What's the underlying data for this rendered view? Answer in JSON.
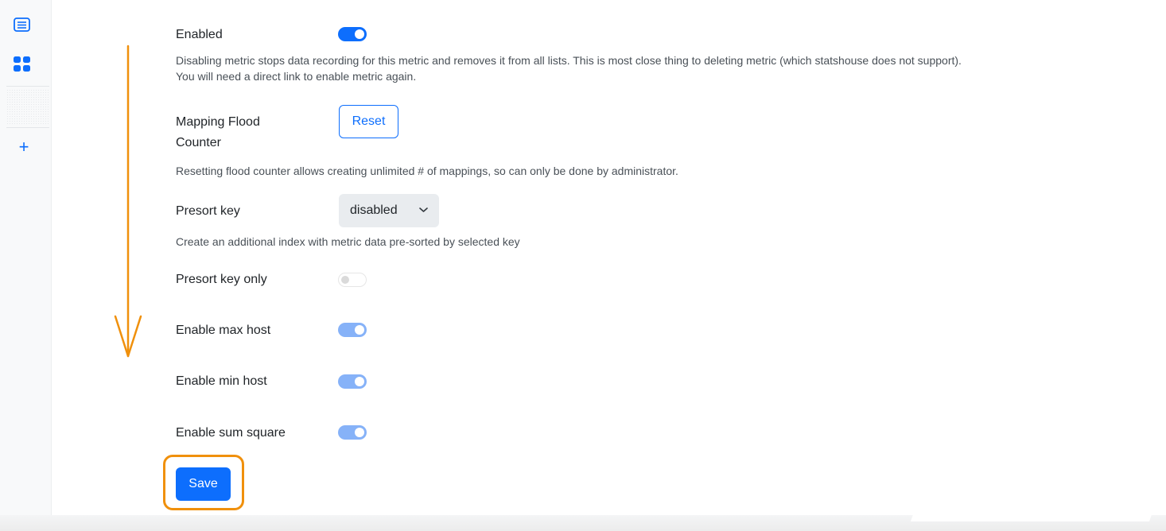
{
  "sidebar": {
    "icons": [
      "list-icon",
      "dashboard-grid-icon",
      "plus-icon"
    ],
    "add_label": "+"
  },
  "form": {
    "enabled": {
      "label": "Enabled",
      "state": "on",
      "description_line1": "Disabling metric stops data recording for this metric and removes it from all lists. This is most close thing to deleting metric (which statshouse does not support).",
      "description_line2": "You will need a direct link to enable metric again."
    },
    "mapping_flood_counter": {
      "label_line1": "Mapping Flood",
      "label_line2": "Counter",
      "button_label": "Reset",
      "description": "Resetting flood counter allows creating unlimited # of mappings, so can only be done by administrator."
    },
    "presort_key": {
      "label": "Presort key",
      "selected_value": "disabled",
      "description": "Create an additional index with metric data pre-sorted by selected key"
    },
    "presort_key_only": {
      "label": "Presort key only",
      "state": "off-disabled"
    },
    "enable_max_host": {
      "label": "Enable max host",
      "state": "on-disabled"
    },
    "enable_min_host": {
      "label": "Enable min host",
      "state": "on-disabled"
    },
    "enable_sum_square": {
      "label": "Enable sum square",
      "state": "on-disabled"
    },
    "save_label": "Save"
  },
  "annotations": {
    "arrow_color": "#f0900c",
    "highlight_color": "#f0900c"
  },
  "colors": {
    "accent": "#0d6efd",
    "accent_disabled": "#86b2f8"
  }
}
